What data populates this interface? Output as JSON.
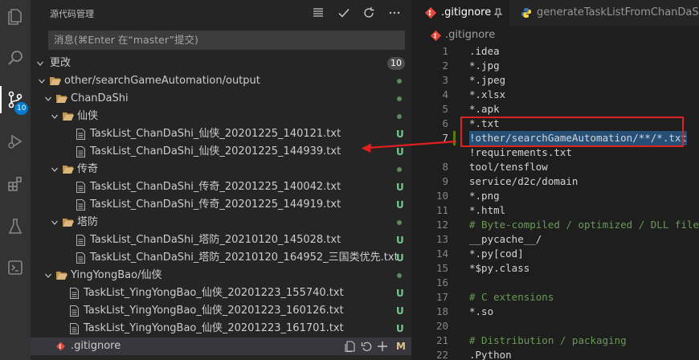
{
  "activity_bar": {
    "items": [
      {
        "name": "explorer-icon"
      },
      {
        "name": "search-icon"
      },
      {
        "name": "source-control-icon",
        "badge": "10",
        "active": true
      },
      {
        "name": "run-debug-icon"
      },
      {
        "name": "extensions-icon"
      },
      {
        "name": "testing-icon"
      },
      {
        "name": "remote-icon"
      }
    ]
  },
  "source_control": {
    "title": "源代码管理",
    "toolbar_icons": [
      "tree-view-icon",
      "commit-check-icon",
      "refresh-icon",
      "more-actions-icon"
    ],
    "commit_placeholder": "消息(⌘Enter 在“master”提交)",
    "changes_label": "更改",
    "changes_count": "10",
    "tree": [
      {
        "type": "folder",
        "label": "other/searchGameAutomation/output"
      },
      {
        "type": "folder",
        "label": "ChanDaShi"
      },
      {
        "type": "folder",
        "label": "仙侠"
      },
      {
        "type": "file",
        "label": "TaskList_ChanDaShi_仙侠_20201225_140121.txt",
        "status": "U"
      },
      {
        "type": "file",
        "label": "TaskList_ChanDaShi_仙侠_20201225_144939.txt",
        "status": "U"
      },
      {
        "type": "folder",
        "label": "传奇"
      },
      {
        "type": "file",
        "label": "TaskList_ChanDaShi_传奇_20201225_140042.txt",
        "status": "U"
      },
      {
        "type": "file",
        "label": "TaskList_ChanDaShi_传奇_20201225_144919.txt",
        "status": "U"
      },
      {
        "type": "folder",
        "label": "塔防"
      },
      {
        "type": "file",
        "label": "TaskList_ChanDaShi_塔防_20210120_145028.txt",
        "status": "U"
      },
      {
        "type": "file",
        "label": "TaskList_ChanDaShi_塔防_20210120_164952_三国类优先.txt",
        "status": "U"
      },
      {
        "type": "folder",
        "label": "YingYongBao/仙侠"
      },
      {
        "type": "file",
        "label": "TaskList_YingYongBao_仙侠_20201223_155740.txt",
        "status": "U"
      },
      {
        "type": "file",
        "label": "TaskList_YingYongBao_仙侠_20201223_160126.txt",
        "status": "U"
      },
      {
        "type": "file",
        "label": "TaskList_YingYongBao_仙侠_20201223_161701.txt",
        "status": "U"
      },
      {
        "type": "git-file",
        "label": ".gitignore",
        "status": "M"
      }
    ]
  },
  "editor": {
    "tabs": [
      {
        "label": ".gitignore",
        "icon": "git-icon",
        "active": true
      },
      {
        "label": "generateTaskListFromChanDaShi",
        "icon": "python-icon",
        "active": false
      }
    ],
    "breadcrumb": ".gitignore",
    "lines": [
      {
        "n": "1",
        "text": ".idea"
      },
      {
        "n": "2",
        "text": "*.jpg"
      },
      {
        "n": "3",
        "text": "*.jpeg"
      },
      {
        "n": "4",
        "text": "*.xlsx"
      },
      {
        "n": "5",
        "text": "*.apk"
      },
      {
        "n": "6",
        "text": "*.txt"
      },
      {
        "n": "7",
        "text": "!other/searchGameAutomation/**/*.txt",
        "highlight": true,
        "current": true
      },
      {
        "n": "",
        "text": "!requirements.txt"
      },
      {
        "n": "8",
        "text": "tool/tensflow"
      },
      {
        "n": "9",
        "text": "service/d2c/domain"
      },
      {
        "n": "10",
        "text": "*.png"
      },
      {
        "n": "11",
        "text": "*.html"
      },
      {
        "n": "12",
        "text": "# Byte-compiled / optimized / DLL files",
        "comment": true
      },
      {
        "n": "13",
        "text": "__pycache__/"
      },
      {
        "n": "14",
        "text": "*.py[cod]"
      },
      {
        "n": "15",
        "text": "*$py.class"
      },
      {
        "n": "16",
        "text": ""
      },
      {
        "n": "17",
        "text": "# C extensions",
        "comment": true
      },
      {
        "n": "18",
        "text": "*.so"
      },
      {
        "n": "20",
        "text": ""
      },
      {
        "n": "21",
        "text": "# Distribution / packaging",
        "comment": true
      },
      {
        "n": "22",
        "text": ".Python"
      }
    ]
  },
  "colors": {
    "annotation": "#e02020",
    "untracked": "#73c991",
    "modified": "#e2c08d",
    "accent": "#007acc"
  }
}
